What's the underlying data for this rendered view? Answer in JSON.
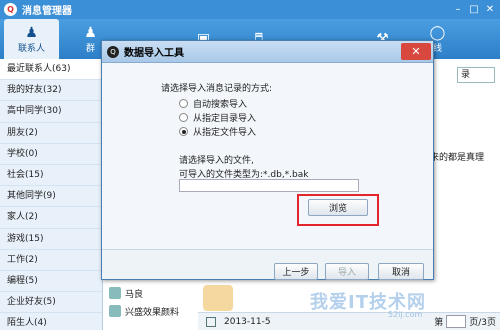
{
  "app": {
    "title": "消息管理器",
    "logo": "qq-penguin-icon"
  },
  "tabs": [
    {
      "label": "联系人",
      "icon": "person-icon"
    },
    {
      "label": "群",
      "icon": "group-icon"
    },
    {
      "label": "",
      "icon": "calendar-icon"
    },
    {
      "label": "",
      "icon": "speaker-icon"
    },
    {
      "label": "",
      "icon": "wrench-icon"
    },
    {
      "label": "线",
      "icon": "online-icon"
    }
  ],
  "sidebar": {
    "items": [
      {
        "label": "最近联系人(63)"
      },
      {
        "label": "我的好友(32)"
      },
      {
        "label": "高中同学(30)"
      },
      {
        "label": "朋友(2)"
      },
      {
        "label": "学校(0)"
      },
      {
        "label": "社会(15)"
      },
      {
        "label": "其他同学(9)"
      },
      {
        "label": "家人(2)"
      },
      {
        "label": "游戏(15)"
      },
      {
        "label": "工作(2)"
      },
      {
        "label": "编程(5)"
      },
      {
        "label": "企业好友(5)"
      },
      {
        "label": "陌生人(4)"
      }
    ]
  },
  "main": {
    "combo_text": "录",
    "side_text": "来的都是真理",
    "contacts": [
      {
        "name": "马良"
      },
      {
        "name": "兴盛效果颜料"
      }
    ],
    "date": "2013-11-5",
    "page_label": "第",
    "page_count": "页/3页"
  },
  "dialog": {
    "title": "数据导入工具",
    "prompt": "请选择导入消息记录的方式:",
    "options": [
      {
        "label": "自动搜索导入",
        "selected": false
      },
      {
        "label": "从指定目录导入",
        "selected": false
      },
      {
        "label": "从指定文件导入",
        "selected": true
      }
    ],
    "file_prompt": "请选择导入的文件,",
    "file_types": "可导入的文件类型为:*.db,*.bak",
    "file_path": "",
    "browse_label": "浏览",
    "prev_label": "上一步",
    "import_label": "导入",
    "cancel_label": "取消"
  },
  "watermark": {
    "text": "我爱IT技术网",
    "url": "52ij.com"
  },
  "colors": {
    "titlebar": "#3b8fd6",
    "highlight_box": "#e3242b",
    "sidebar_bg": "#e8f1fa"
  }
}
